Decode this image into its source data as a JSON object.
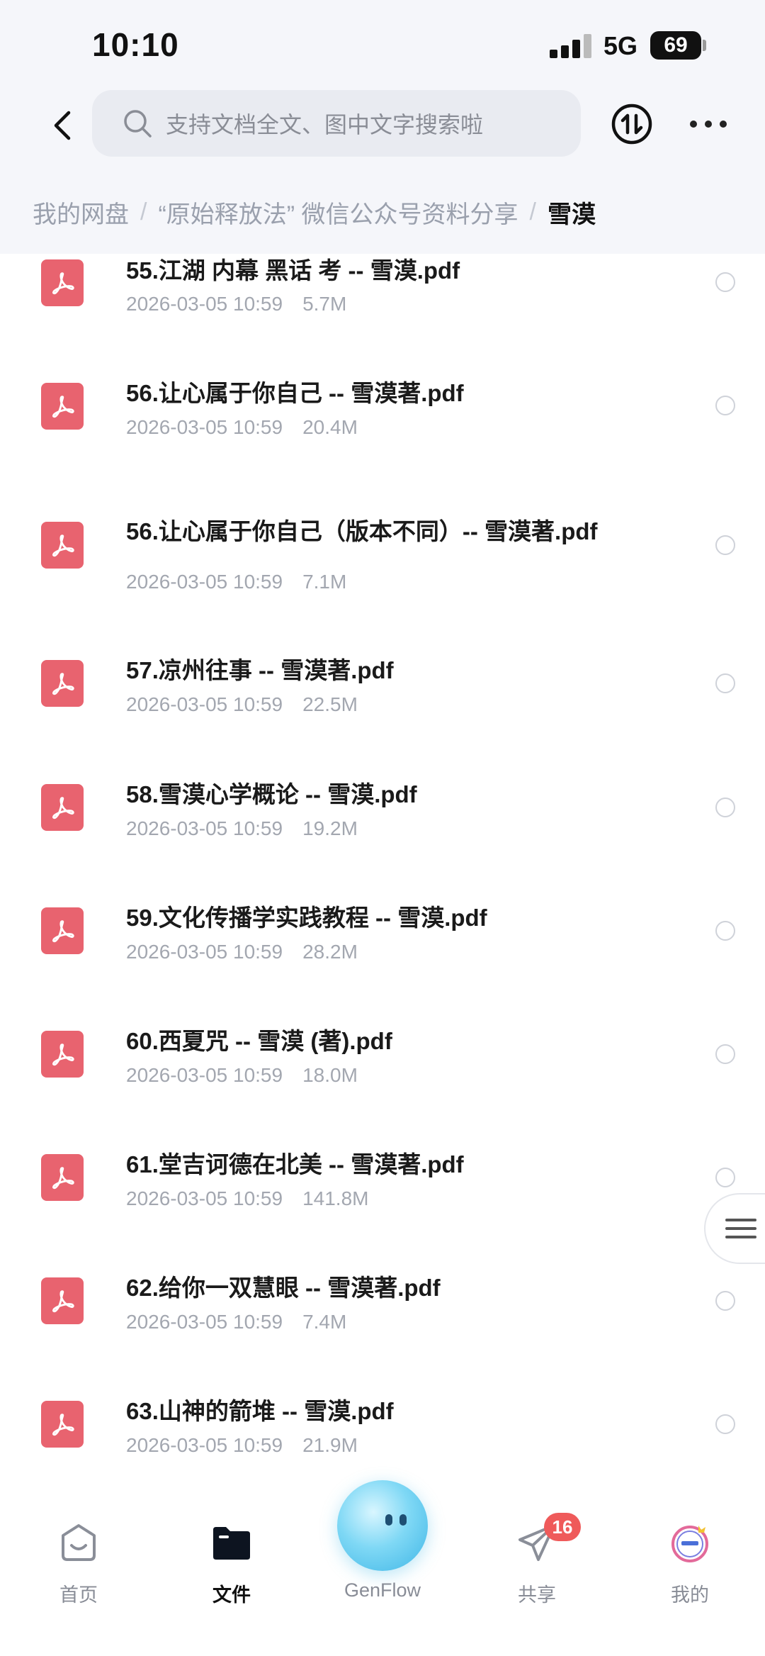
{
  "status_bar": {
    "time": "10:10",
    "network": "5G",
    "battery": "69"
  },
  "header": {
    "search_placeholder": "支持文档全文、图中文字搜索啦"
  },
  "breadcrumb": {
    "items": [
      "我的网盘",
      "“原始释放法” 微信公众号资料分享"
    ],
    "separator": "/",
    "current": "雪漠"
  },
  "files": [
    {
      "name": "55.江湖 内幕 黑话 考 -- 雪漠.pdf",
      "date": "2026-03-05 10:59",
      "size": "5.7M"
    },
    {
      "name": "56.让心属于你自己 -- 雪漠著.pdf",
      "date": "2026-03-05 10:59",
      "size": "20.4M"
    },
    {
      "name": "56.让心属于你自己（版本不同）-- 雪漠著.pdf",
      "date": "2026-03-05 10:59",
      "size": "7.1M"
    },
    {
      "name": "57.凉州往事 -- 雪漠著.pdf",
      "date": "2026-03-05 10:59",
      "size": "22.5M"
    },
    {
      "name": "58.雪漠心学概论 -- 雪漠.pdf",
      "date": "2026-03-05 10:59",
      "size": "19.2M"
    },
    {
      "name": "59.文化传播学实践教程 -- 雪漠.pdf",
      "date": "2026-03-05 10:59",
      "size": "28.2M"
    },
    {
      "name": "60.西夏咒 -- 雪漠 (著).pdf",
      "date": "2026-03-05 10:59",
      "size": "18.0M"
    },
    {
      "name": "61.堂吉诃德在北美 -- 雪漠著.pdf",
      "date": "2026-03-05 10:59",
      "size": "141.8M"
    },
    {
      "name": "62.给你一双慧眼 -- 雪漠著.pdf",
      "date": "2026-03-05 10:59",
      "size": "7.4M"
    },
    {
      "name": "63.山神的箭堆 -- 雪漠.pdf",
      "date": "2026-03-05 10:59",
      "size": "21.9M"
    }
  ],
  "bottom_nav": {
    "home": "首页",
    "files": "文件",
    "genflow": "GenFlow",
    "share": "共享",
    "share_badge": "16",
    "mine": "我的"
  },
  "colors": {
    "pdf_red": "#e8636f",
    "badge_red": "#ef5a5a",
    "page_bg": "#f5f6fa"
  }
}
